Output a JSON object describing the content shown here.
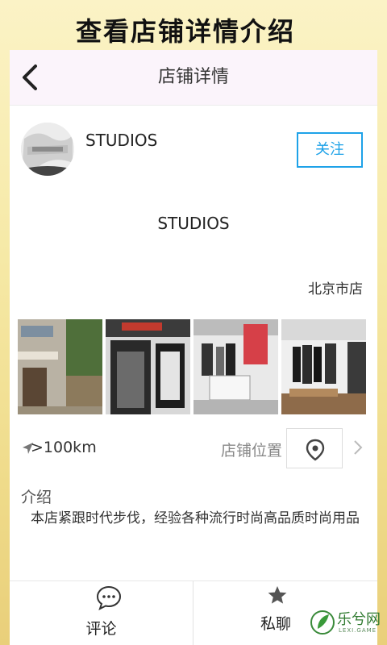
{
  "banner": {
    "title": "查看店铺详情介绍"
  },
  "nav": {
    "title": "店铺详情"
  },
  "shop": {
    "name": "STUDIOS",
    "follow_label": "关注",
    "display_name": "STUDIOS",
    "city": "北京市店"
  },
  "location": {
    "distance": ">100km",
    "label": "店铺位置"
  },
  "intro": {
    "title": "介绍",
    "text": "本店紧跟时代步伐，经验各种流行时尚高品质时尚用品"
  },
  "tabs": {
    "comment": "评论",
    "chat": "私聊"
  },
  "watermark": {
    "name": "乐兮网",
    "sub": "LEXI.GAME"
  },
  "colors": {
    "accent": "#1ea2e8",
    "nav_bg": "#fbf4fb"
  }
}
